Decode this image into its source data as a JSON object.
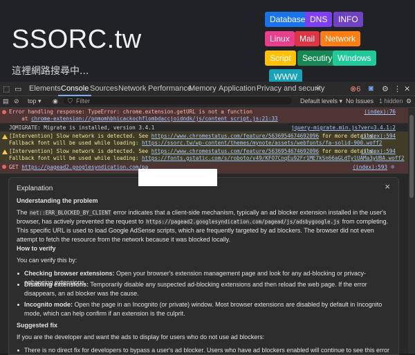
{
  "site": {
    "title": "SSORC.tw",
    "subtitle": "這裡網路搜尋中...",
    "tags": [
      {
        "label": "Database",
        "color": "#1a73e8"
      },
      {
        "label": "DNS",
        "color": "#7e3ff2"
      },
      {
        "label": "INFO",
        "color": "#6f42c1"
      },
      {
        "label": "Linux",
        "color": "#e83e8c"
      },
      {
        "label": "Mail",
        "color": "#dc3545"
      },
      {
        "label": "Network",
        "color": "#fd7e14"
      },
      {
        "label": "Script",
        "color": "#ffc107"
      },
      {
        "label": "Secutiry",
        "color": "#198754"
      },
      {
        "label": "Windows",
        "color": "#20c997"
      },
      {
        "label": "WWW",
        "color": "#17a2b8"
      }
    ]
  },
  "devtools": {
    "tabs": [
      "Elements",
      "Console",
      "Sources",
      "Network",
      "Performance",
      "Memory",
      "Application",
      "Privacy and security"
    ],
    "active_tab": "Console",
    "more_tabs": "»",
    "error_count": "6",
    "toolbar": {
      "context": "top",
      "filter_placeholder": "Filter",
      "levels": "Default levels",
      "issues": "No Issues",
      "hidden": "1 hidden"
    }
  },
  "console": {
    "messages": [
      {
        "type": "error",
        "line1": "Error handling response: TypeError: chrome.extension.getURL is not a function",
        "line2_prefix": "    at ",
        "line2_link": "chrome-extension://pnmomhbhicackochflombdaccjoidndk/js/content_script.js:21:33",
        "source": "(index):76"
      },
      {
        "type": "plain",
        "line1": "JQMIGRATE: Migrate is installed, version 3.4.1",
        "source": "jquery-migrate.min.js?ver=3.4.1:2"
      },
      {
        "type": "warn",
        "line1_prefix": "[Intervention] Slow network is detected. See ",
        "line1_link": "https://www.chromestatus.com/feature/5636954674692096",
        "line1_suffix": " for more details.",
        "line2_prefix": "Fallback font will be used while loading: ",
        "line2_link": "https://ssorc.tw/wp-content/themes/mynote/assets/webfonts/fa-solid-900.woff2",
        "source": "(index):594"
      },
      {
        "type": "warn",
        "line1_prefix": "[Intervention] Slow network is detected. See ",
        "line1_link": "https://www.chromestatus.com/feature/5636954674692096",
        "line1_suffix": " for more details.",
        "line2_prefix": "Fallback font will be used while loading: ",
        "line2_link": "https://fonts.gstatic.com/s/roboto/v49/KFO7CnqEu92Fr1ME7kSn66aGLdTylUAMa3yUBA.woff2",
        "source": "(index):594"
      },
      {
        "type": "error",
        "line1_prefix": "GET ",
        "line1_link": "https://pagead2.googlesyndication.com/pa",
        "source": "(index):593"
      }
    ]
  },
  "explanation": {
    "title": "Explanation",
    "close": "×",
    "h1": "Understanding the problem",
    "p1a": "The ",
    "p1code1": "net::ERR_BLOCKED_BY_CLIENT",
    "p1b": " error indicates that a client-side mechanism, typically an ad blocker extension installed in the user's browser, has actively prevented the request to ",
    "p1code2": "https://pagead2.googlesyndication.com/pagead/js/adsbygoogle.js",
    "p1c": " from completing. This specific URL is used to load Google AdSense scripts, which are frequently targeted by ad blockers. The browser did not even attempt to fetch the resource from the network because it was blocked locally.",
    "h2": "How to verify",
    "p2": "You can verify this by:",
    "b1_strong": "Checking browser extensions:",
    "b1": " Open your browser's extension management page and look for any ad-blocking or privacy-enhancing extensions.",
    "b2_strong": "Disabling extensions:",
    "b2": " Temporarily disable any suspected ad-blocking extensions and then reload the web page. If the error disappears, an ad blocker was the cause.",
    "b3_strong": "Incognito mode:",
    "b3": " Open the page in an Incognito (or private) window. Most browser extensions are disabled by default in Incognito mode, which can help confirm if an extension is the culprit.",
    "h3": "Suggested fix",
    "p3": "If you are the developer and want the ads to display for users who do not use ad blockers:",
    "b4": "There is no direct fix for developers to bypass a user's ad blocker. Users who have ad blockers enabled will continue to see this error and the"
  }
}
